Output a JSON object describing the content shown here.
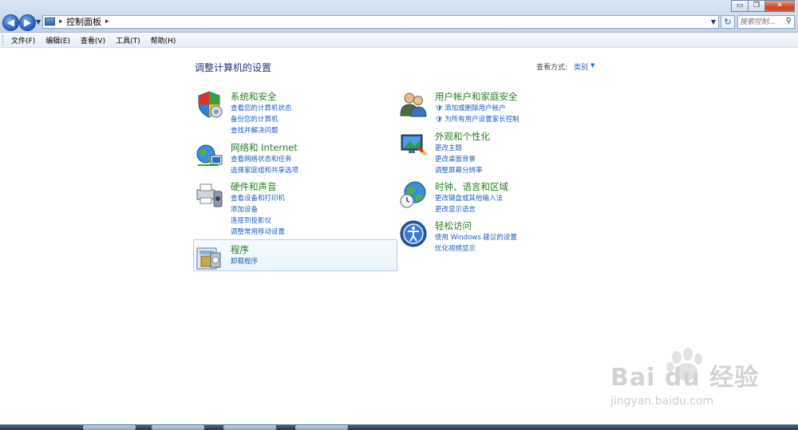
{
  "address_bar": {
    "crumb": "控制面板",
    "separator": "▸"
  },
  "search": {
    "placeholder": "搜索控制..."
  },
  "window_buttons": {
    "minimize": "▭",
    "maximize": "❐",
    "close": "✕"
  },
  "menu": [
    "文件(F)",
    "编辑(E)",
    "查看(V)",
    "工具(T)",
    "帮助(H)"
  ],
  "content": {
    "title": "调整计算机的设置",
    "view_by_label": "查看方式:",
    "view_by_value": "类别"
  },
  "categories": {
    "system": {
      "title": "系统和安全",
      "links": [
        "查看您的计算机状态",
        "备份您的计算机",
        "查找并解决问题"
      ]
    },
    "network": {
      "title": "网络和 Internet",
      "links": [
        "查看网络状态和任务",
        "选择家庭组和共享选项"
      ]
    },
    "hardware": {
      "title": "硬件和声音",
      "links": [
        "查看设备和打印机",
        "添加设备",
        "连接到投影仪",
        "调整常用移动设置"
      ]
    },
    "programs": {
      "title": "程序",
      "links": [
        "卸载程序"
      ]
    },
    "users": {
      "title": "用户帐户和家庭安全",
      "links": [
        "添加或删除用户帐户",
        "为所有用户设置家长控制"
      ]
    },
    "appearance": {
      "title": "外观和个性化",
      "links": [
        "更改主题",
        "更改桌面背景",
        "调整屏幕分辨率"
      ]
    },
    "clock": {
      "title": "时钟、语言和区域",
      "links": [
        "更改键盘或其他输入法",
        "更改显示语言"
      ]
    },
    "ease": {
      "title": "轻松访问",
      "links": [
        "使用 Windows 建议的设置",
        "优化视频显示"
      ]
    }
  },
  "watermark": {
    "brand": "Bai du 经验",
    "url": "jingyan.baidu.com"
  },
  "colors": {
    "title_green": "#247e1c",
    "link_blue": "#1e5ebf",
    "heading_blue": "#1e3287"
  }
}
